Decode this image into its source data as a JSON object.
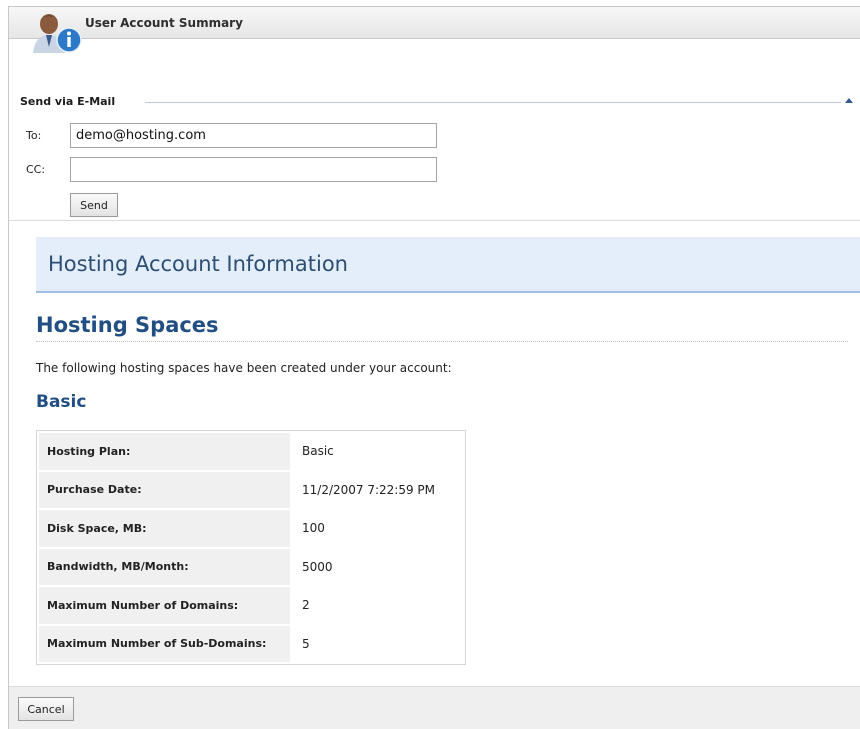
{
  "window": {
    "title": "User Account Summary"
  },
  "icons": {
    "user_info": "user-info-icon",
    "collapse": "collapse-arrow-icon"
  },
  "send_email": {
    "section_title": "Send via E-Mail",
    "to_label": "To:",
    "to_value": "demo@hosting.com",
    "cc_label": "CC:",
    "cc_value": "",
    "send_label": "Send"
  },
  "report": {
    "header": "Hosting Account Information",
    "spaces_heading": "Hosting Spaces",
    "intro": "The following hosting spaces have been created under your account:",
    "plan_name": "Basic",
    "rows": [
      {
        "label": "Hosting Plan:",
        "value": "Basic"
      },
      {
        "label": "Purchase Date:",
        "value": "11/2/2007 7:22:59 PM"
      },
      {
        "label": "Disk Space, MB:",
        "value": "100"
      },
      {
        "label": "Bandwidth, MB/Month:",
        "value": "5000"
      },
      {
        "label": "Maximum Number of Domains:",
        "value": "2"
      },
      {
        "label": "Maximum Number of Sub-Domains:",
        "value": "5"
      }
    ]
  },
  "footer": {
    "cancel_label": "Cancel"
  },
  "colors": {
    "heading_blue": "#224f83",
    "header_bg": "#e3eefa",
    "header_border": "#9ec0e8"
  }
}
